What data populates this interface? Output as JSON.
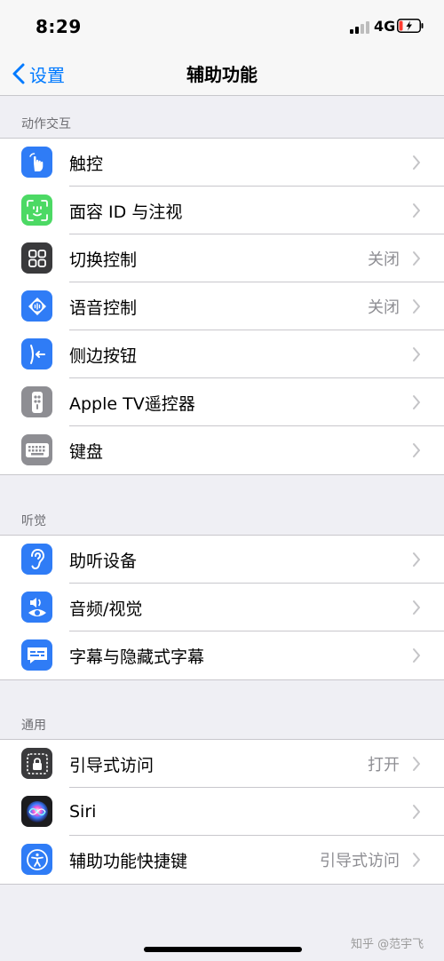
{
  "status": {
    "time": "8:29",
    "network": "4G"
  },
  "nav": {
    "back_label": "设置",
    "title": "辅助功能"
  },
  "sections": [
    {
      "header": "动作交互",
      "rows": [
        {
          "label": "触控",
          "value": "",
          "icon": "touch-icon",
          "color": "#2f7cf6"
        },
        {
          "label": "面容 ID 与注视",
          "value": "",
          "icon": "face-id-icon",
          "color": "#4cd964"
        },
        {
          "label": "切换控制",
          "value": "关闭",
          "icon": "switch-control-icon",
          "color": "#3a3a3c"
        },
        {
          "label": "语音控制",
          "value": "关闭",
          "icon": "voice-control-icon",
          "color": "#2f7cf6"
        },
        {
          "label": "侧边按钮",
          "value": "",
          "icon": "side-button-icon",
          "color": "#2f7cf6"
        },
        {
          "label": "Apple TV遥控器",
          "value": "",
          "icon": "apple-tv-remote-icon",
          "color": "#8e8e93"
        },
        {
          "label": "键盘",
          "value": "",
          "icon": "keyboard-icon",
          "color": "#8e8e93"
        }
      ]
    },
    {
      "header": "听觉",
      "rows": [
        {
          "label": "助听设备",
          "value": "",
          "icon": "ear-icon",
          "color": "#2f7cf6"
        },
        {
          "label": "音频/视觉",
          "value": "",
          "icon": "audio-visual-icon",
          "color": "#2f7cf6"
        },
        {
          "label": "字幕与隐藏式字幕",
          "value": "",
          "icon": "subtitles-icon",
          "color": "#2f7cf6"
        }
      ]
    },
    {
      "header": "通用",
      "rows": [
        {
          "label": "引导式访问",
          "value": "打开",
          "icon": "guided-access-icon",
          "color": "#3a3a3c"
        },
        {
          "label": "Siri",
          "value": "",
          "icon": "siri-icon",
          "color": "#1c1c1e"
        },
        {
          "label": "辅助功能快捷键",
          "value": "引导式访问",
          "icon": "accessibility-icon",
          "color": "#2f7cf6"
        }
      ]
    }
  ],
  "watermark": "知乎 @范宇飞"
}
